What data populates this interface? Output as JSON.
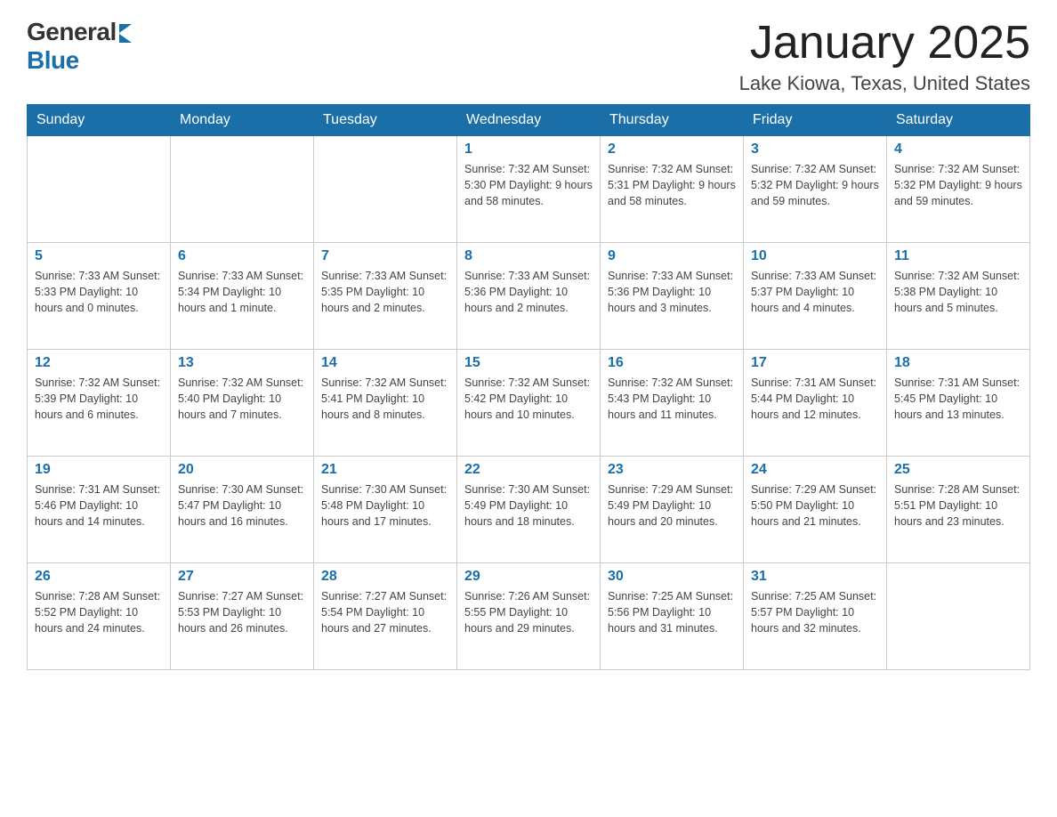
{
  "header": {
    "logo_general": "General",
    "logo_blue": "Blue",
    "month_title": "January 2025",
    "location": "Lake Kiowa, Texas, United States"
  },
  "days_of_week": [
    "Sunday",
    "Monday",
    "Tuesday",
    "Wednesday",
    "Thursday",
    "Friday",
    "Saturday"
  ],
  "weeks": [
    [
      {
        "day": "",
        "info": ""
      },
      {
        "day": "",
        "info": ""
      },
      {
        "day": "",
        "info": ""
      },
      {
        "day": "1",
        "info": "Sunrise: 7:32 AM\nSunset: 5:30 PM\nDaylight: 9 hours and 58 minutes."
      },
      {
        "day": "2",
        "info": "Sunrise: 7:32 AM\nSunset: 5:31 PM\nDaylight: 9 hours and 58 minutes."
      },
      {
        "day": "3",
        "info": "Sunrise: 7:32 AM\nSunset: 5:32 PM\nDaylight: 9 hours and 59 minutes."
      },
      {
        "day": "4",
        "info": "Sunrise: 7:32 AM\nSunset: 5:32 PM\nDaylight: 9 hours and 59 minutes."
      }
    ],
    [
      {
        "day": "5",
        "info": "Sunrise: 7:33 AM\nSunset: 5:33 PM\nDaylight: 10 hours and 0 minutes."
      },
      {
        "day": "6",
        "info": "Sunrise: 7:33 AM\nSunset: 5:34 PM\nDaylight: 10 hours and 1 minute."
      },
      {
        "day": "7",
        "info": "Sunrise: 7:33 AM\nSunset: 5:35 PM\nDaylight: 10 hours and 2 minutes."
      },
      {
        "day": "8",
        "info": "Sunrise: 7:33 AM\nSunset: 5:36 PM\nDaylight: 10 hours and 2 minutes."
      },
      {
        "day": "9",
        "info": "Sunrise: 7:33 AM\nSunset: 5:36 PM\nDaylight: 10 hours and 3 minutes."
      },
      {
        "day": "10",
        "info": "Sunrise: 7:33 AM\nSunset: 5:37 PM\nDaylight: 10 hours and 4 minutes."
      },
      {
        "day": "11",
        "info": "Sunrise: 7:32 AM\nSunset: 5:38 PM\nDaylight: 10 hours and 5 minutes."
      }
    ],
    [
      {
        "day": "12",
        "info": "Sunrise: 7:32 AM\nSunset: 5:39 PM\nDaylight: 10 hours and 6 minutes."
      },
      {
        "day": "13",
        "info": "Sunrise: 7:32 AM\nSunset: 5:40 PM\nDaylight: 10 hours and 7 minutes."
      },
      {
        "day": "14",
        "info": "Sunrise: 7:32 AM\nSunset: 5:41 PM\nDaylight: 10 hours and 8 minutes."
      },
      {
        "day": "15",
        "info": "Sunrise: 7:32 AM\nSunset: 5:42 PM\nDaylight: 10 hours and 10 minutes."
      },
      {
        "day": "16",
        "info": "Sunrise: 7:32 AM\nSunset: 5:43 PM\nDaylight: 10 hours and 11 minutes."
      },
      {
        "day": "17",
        "info": "Sunrise: 7:31 AM\nSunset: 5:44 PM\nDaylight: 10 hours and 12 minutes."
      },
      {
        "day": "18",
        "info": "Sunrise: 7:31 AM\nSunset: 5:45 PM\nDaylight: 10 hours and 13 minutes."
      }
    ],
    [
      {
        "day": "19",
        "info": "Sunrise: 7:31 AM\nSunset: 5:46 PM\nDaylight: 10 hours and 14 minutes."
      },
      {
        "day": "20",
        "info": "Sunrise: 7:30 AM\nSunset: 5:47 PM\nDaylight: 10 hours and 16 minutes."
      },
      {
        "day": "21",
        "info": "Sunrise: 7:30 AM\nSunset: 5:48 PM\nDaylight: 10 hours and 17 minutes."
      },
      {
        "day": "22",
        "info": "Sunrise: 7:30 AM\nSunset: 5:49 PM\nDaylight: 10 hours and 18 minutes."
      },
      {
        "day": "23",
        "info": "Sunrise: 7:29 AM\nSunset: 5:49 PM\nDaylight: 10 hours and 20 minutes."
      },
      {
        "day": "24",
        "info": "Sunrise: 7:29 AM\nSunset: 5:50 PM\nDaylight: 10 hours and 21 minutes."
      },
      {
        "day": "25",
        "info": "Sunrise: 7:28 AM\nSunset: 5:51 PM\nDaylight: 10 hours and 23 minutes."
      }
    ],
    [
      {
        "day": "26",
        "info": "Sunrise: 7:28 AM\nSunset: 5:52 PM\nDaylight: 10 hours and 24 minutes."
      },
      {
        "day": "27",
        "info": "Sunrise: 7:27 AM\nSunset: 5:53 PM\nDaylight: 10 hours and 26 minutes."
      },
      {
        "day": "28",
        "info": "Sunrise: 7:27 AM\nSunset: 5:54 PM\nDaylight: 10 hours and 27 minutes."
      },
      {
        "day": "29",
        "info": "Sunrise: 7:26 AM\nSunset: 5:55 PM\nDaylight: 10 hours and 29 minutes."
      },
      {
        "day": "30",
        "info": "Sunrise: 7:25 AM\nSunset: 5:56 PM\nDaylight: 10 hours and 31 minutes."
      },
      {
        "day": "31",
        "info": "Sunrise: 7:25 AM\nSunset: 5:57 PM\nDaylight: 10 hours and 32 minutes."
      },
      {
        "day": "",
        "info": ""
      }
    ]
  ]
}
